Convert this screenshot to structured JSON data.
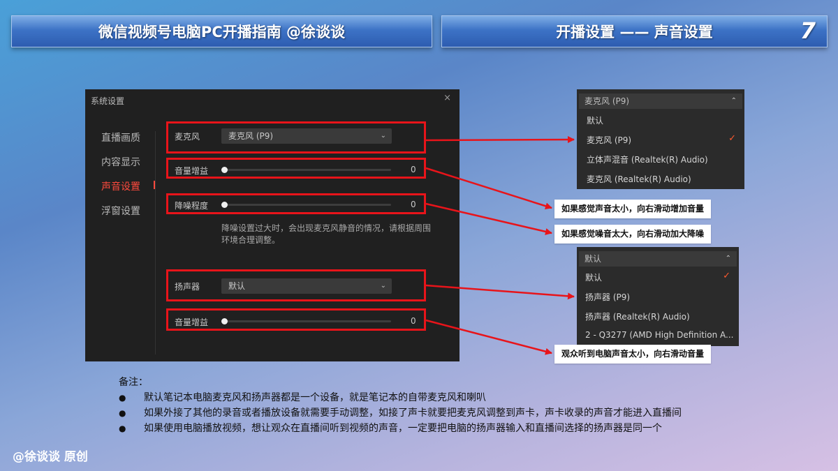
{
  "header": {
    "left_title": "微信视频号电脑PC开播指南 @徐谈谈",
    "right_title": "开播设置 —— 声音设置",
    "page_number": "7"
  },
  "settings_window": {
    "title": "系统设置",
    "close_icon": "×",
    "nav": [
      {
        "label": "直播画质",
        "active": false
      },
      {
        "label": "内容显示",
        "active": false
      },
      {
        "label": "声音设置",
        "active": true
      },
      {
        "label": "浮窗设置",
        "active": false
      }
    ],
    "mic_label": "麦克风",
    "mic_value": "麦克风 (P9)",
    "mic_gain_label": "音量增益",
    "mic_gain_value": "0",
    "noise_label": "降噪程度",
    "noise_value": "0",
    "noise_hint": "降噪设置过大时，会出现麦克风静音的情况，请根据周围环境合理调整。",
    "speaker_label": "扬声器",
    "speaker_value": "默认",
    "speaker_gain_label": "音量增益",
    "speaker_gain_value": "0"
  },
  "mic_dropdown": {
    "header": "麦克风 (P9)",
    "items": [
      "默认",
      "麦克风 (P9)",
      "立体声混音 (Realtek(R) Audio)",
      "麦克风 (Realtek(R) Audio)"
    ],
    "selected_index": 1
  },
  "speaker_dropdown": {
    "header": "默认",
    "items": [
      "默认",
      "扬声器 (P9)",
      "扬声器 (Realtek(R) Audio)",
      "2 - Q3277 (AMD High Definition A..."
    ],
    "selected_index": 0
  },
  "callouts": {
    "mic_gain": "如果感觉声音太小，向右滑动增加音量",
    "noise": "如果感觉噪音太大，向右滑动加大降噪",
    "speaker_gain": "观众听到电脑声音太小，向右滑动音量"
  },
  "notes": {
    "title": "备注：",
    "bullet": "●",
    "items": [
      "默认笔记本电脑麦克风和扬声器都是一个设备，就是笔记本的自带麦克风和喇叭",
      "如果外接了其他的录音或者播放设备就需要手动调整，如接了声卡就要把麦克风调整到声卡，声卡收录的声音才能进入直播间",
      "如果使用电脑播放视频，想让观众在直播间听到视频的声音，一定要把电脑的扬声器输入和直播间选择的扬声器是同一个"
    ]
  },
  "watermark": "@徐谈谈 原创",
  "colors": {
    "highlight_red": "#e8141a",
    "active_nav": "#ff4a3d",
    "check": "#ff5a2e"
  }
}
